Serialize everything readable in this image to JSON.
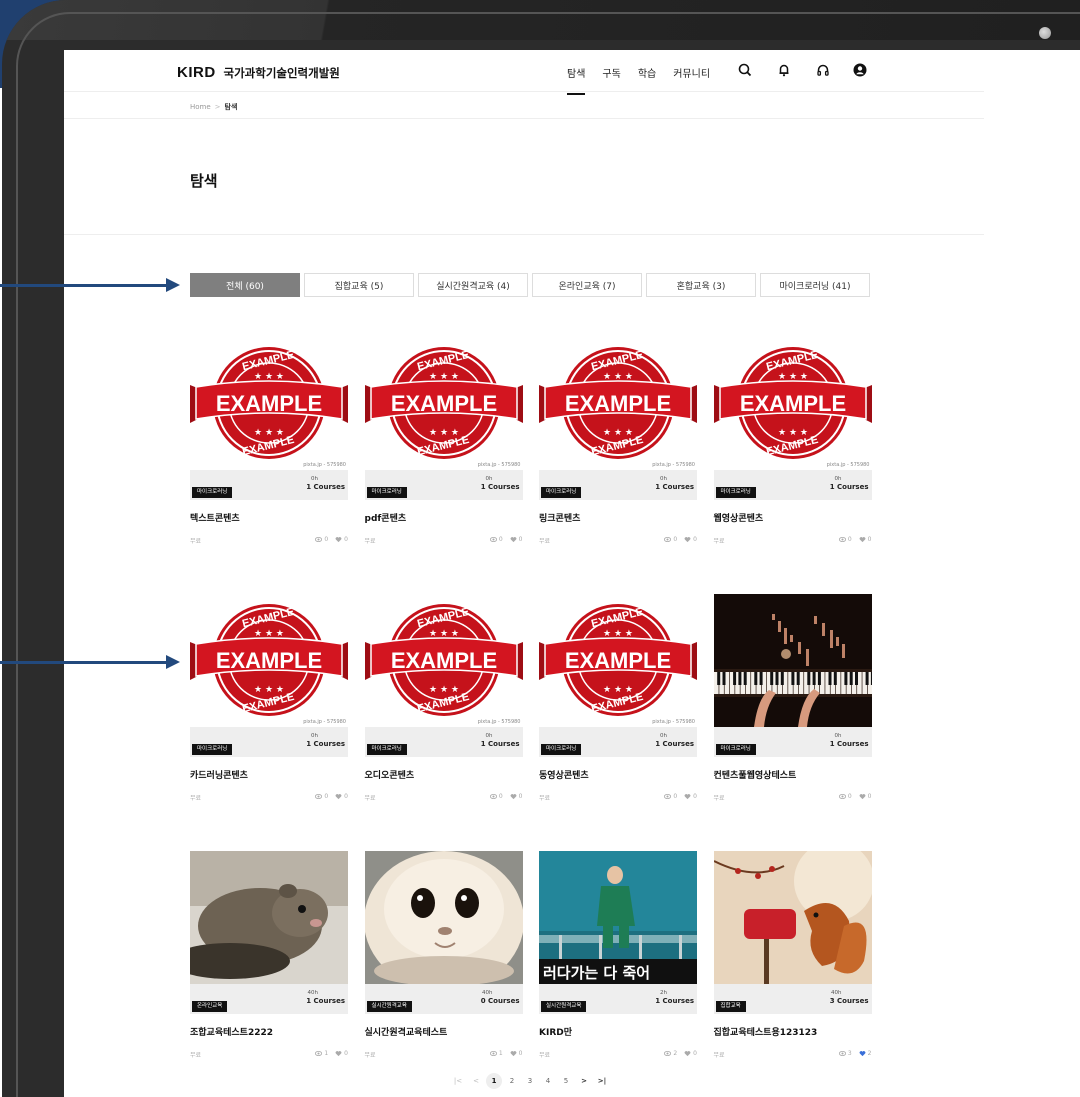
{
  "header": {
    "brand": "KIRD",
    "org_name": "국가과학기술인력개발원",
    "nav": [
      "탐색",
      "구독",
      "학습",
      "커뮤니티"
    ]
  },
  "breadcrumb": {
    "home": "Home",
    "current": "탐색"
  },
  "page_title": "탐색",
  "tabs": [
    "전체 (60)",
    "집합교육 (5)",
    "실시간원격교육 (4)",
    "온라인교육 (7)",
    "혼합교육 (3)",
    "마이크로러닝 (41)"
  ],
  "cards": [
    {
      "title": "텍스트콘텐츠",
      "category": "마이크로러닝",
      "duration": "0h",
      "courses": "1 Courses",
      "price": "무료",
      "views": "0",
      "likes": "0",
      "watermark": "pixta.jp - 575980"
    },
    {
      "title": "pdf콘텐츠",
      "category": "마이크로러닝",
      "duration": "0h",
      "courses": "1 Courses",
      "price": "무료",
      "views": "0",
      "likes": "0",
      "watermark": "pixta.jp - 575980"
    },
    {
      "title": "링크콘텐츠",
      "category": "마이크로러닝",
      "duration": "0h",
      "courses": "1 Courses",
      "price": "무료",
      "views": "0",
      "likes": "0",
      "watermark": "pixta.jp - 575980"
    },
    {
      "title": "웹영상콘텐츠",
      "category": "마이크로러닝",
      "duration": "0h",
      "courses": "1 Courses",
      "price": "무료",
      "views": "0",
      "likes": "0",
      "watermark": "pixta.jp - 575980"
    },
    {
      "title": "카드러닝콘텐츠",
      "category": "마이크로러닝",
      "duration": "0h",
      "courses": "1 Courses",
      "price": "무료",
      "views": "0",
      "likes": "0",
      "watermark": "pixta.jp - 575980"
    },
    {
      "title": "오디오콘텐츠",
      "category": "마이크로러닝",
      "duration": "0h",
      "courses": "1 Courses",
      "price": "무료",
      "views": "0",
      "likes": "0",
      "watermark": "pixta.jp - 575980"
    },
    {
      "title": "동영상콘텐츠",
      "category": "마이크로러닝",
      "duration": "0h",
      "courses": "1 Courses",
      "price": "무료",
      "views": "0",
      "likes": "0",
      "watermark": "pixta.jp - 575980"
    },
    {
      "title": "컨텐츠풀웹영상테스트",
      "category": "마이크로러닝",
      "duration": "0h",
      "courses": "1 Courses",
      "price": "무료",
      "views": "0",
      "likes": "0",
      "watermark": ""
    },
    {
      "title": "조합교육테스트2222",
      "category": "온라인교육",
      "duration": "40h",
      "courses": "1 Courses",
      "price": "무료",
      "views": "1",
      "likes": "0",
      "watermark": ""
    },
    {
      "title": "실시간원격교육테스트",
      "category": "실시간원격교육",
      "duration": "40h",
      "courses": "0 Courses",
      "price": "무료",
      "views": "1",
      "likes": "0",
      "watermark": ""
    },
    {
      "title": "KIRD만",
      "category": "실시간원격교육",
      "duration": "2h",
      "courses": "1 Courses",
      "price": "무료",
      "views": "2",
      "likes": "0",
      "watermark": ""
    },
    {
      "title": "집합교육테스트용123123",
      "category": "집합교육",
      "duration": "40h",
      "courses": "3 Courses",
      "price": "무료",
      "views": "3",
      "likes": "2",
      "watermark": ""
    }
  ],
  "thumb_text": {
    "example": "EXAMPLE",
    "banner_overlay": "러다가는 다 죽어"
  },
  "pagination": {
    "first": "|<",
    "prev": "<",
    "pages": [
      "1",
      "2",
      "3",
      "4",
      "5"
    ],
    "current": "1",
    "next": ">",
    "last": ">|"
  },
  "colors": {
    "accent_dark": "#111111",
    "tab_active_bg": "#7f7f7f",
    "presentation_arrow": "#22497d",
    "liked_heart": "#3a6fd8"
  }
}
